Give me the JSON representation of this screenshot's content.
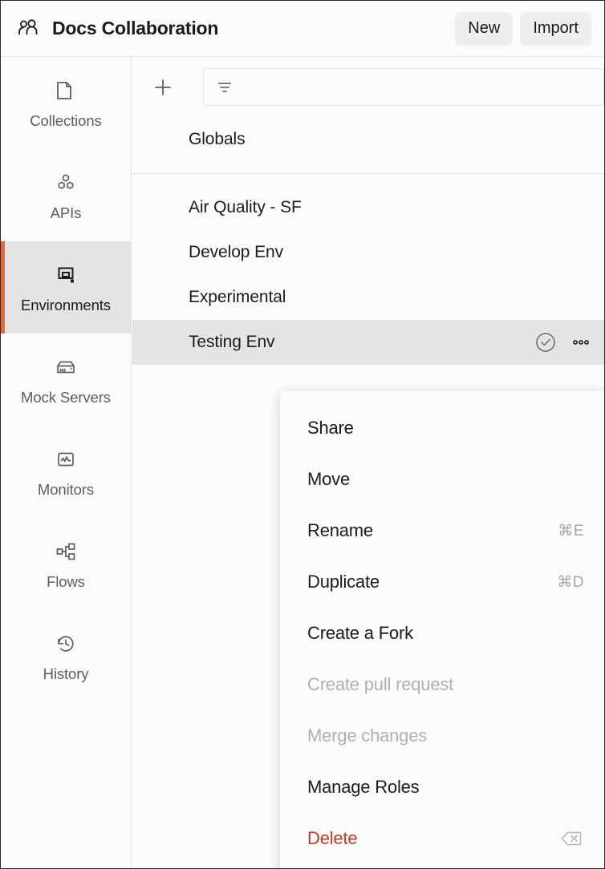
{
  "theme": {
    "accent": "#e2683c",
    "danger": "#c0392b",
    "selected_bg": "#e4e4e4",
    "panel_bg": "#fbfbfb"
  },
  "header": {
    "team_icon": "people-icon",
    "title": "Docs Collaboration",
    "new_label": "New",
    "import_label": "Import"
  },
  "sidebar": {
    "items": [
      {
        "label": "Collections",
        "icon": "collections-icon",
        "active": false
      },
      {
        "label": "APIs",
        "icon": "apis-icon",
        "active": false
      },
      {
        "label": "Environments",
        "icon": "environments-icon",
        "active": true
      },
      {
        "label": "Mock Servers",
        "icon": "mock-servers-icon",
        "active": false
      },
      {
        "label": "Monitors",
        "icon": "monitors-icon",
        "active": false
      },
      {
        "label": "Flows",
        "icon": "flows-icon",
        "active": false
      },
      {
        "label": "History",
        "icon": "history-icon",
        "active": false
      }
    ]
  },
  "toolbar": {
    "create_icon": "plus-icon",
    "filter_icon": "filter-icon",
    "filter_value": "",
    "filter_placeholder": ""
  },
  "environments": {
    "globals": {
      "name": "Globals"
    },
    "items": [
      {
        "name": "Air Quality - SF",
        "selected": false
      },
      {
        "name": "Develop Env",
        "selected": false
      },
      {
        "name": "Experimental",
        "selected": false
      },
      {
        "name": "Testing Env",
        "selected": true
      }
    ],
    "selected_row_actions": {
      "activate_icon": "check-circle-icon",
      "more_icon": "more-horizontal-icon"
    }
  },
  "context_menu": {
    "items": [
      {
        "label": "Share",
        "shortcut": "",
        "shortcut_icon": "",
        "state": "enabled"
      },
      {
        "label": "Move",
        "shortcut": "",
        "shortcut_icon": "",
        "state": "enabled"
      },
      {
        "label": "Rename",
        "shortcut": "⌘E",
        "shortcut_icon": "",
        "state": "enabled"
      },
      {
        "label": "Duplicate",
        "shortcut": "⌘D",
        "shortcut_icon": "",
        "state": "enabled"
      },
      {
        "label": "Create a Fork",
        "shortcut": "",
        "shortcut_icon": "",
        "state": "enabled"
      },
      {
        "label": "Create pull request",
        "shortcut": "",
        "shortcut_icon": "",
        "state": "disabled"
      },
      {
        "label": "Merge changes",
        "shortcut": "",
        "shortcut_icon": "",
        "state": "disabled"
      },
      {
        "label": "Manage Roles",
        "shortcut": "",
        "shortcut_icon": "",
        "state": "enabled"
      },
      {
        "label": "Delete",
        "shortcut": "",
        "shortcut_icon": "backspace-key-icon",
        "state": "danger"
      }
    ]
  }
}
